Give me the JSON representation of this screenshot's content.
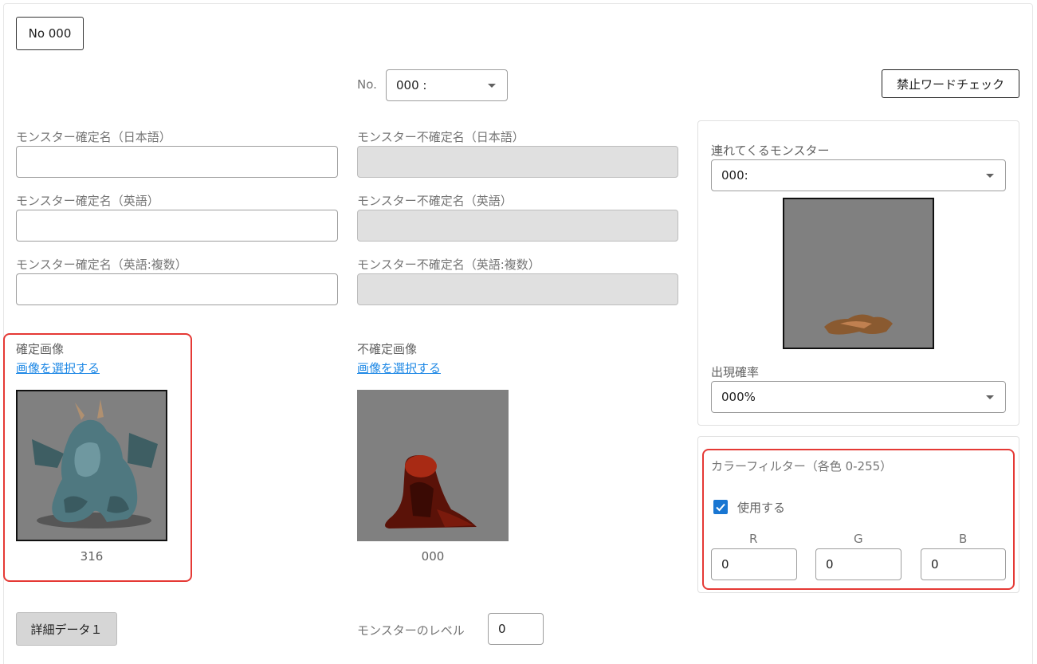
{
  "header": {
    "no_badge": "No 000"
  },
  "no_select": {
    "label": "No.",
    "value": "000 :"
  },
  "ng_word_button": "禁止ワードチェック",
  "names": {
    "confirmed_ja_label": "モンスター確定名（日本語）",
    "confirmed_ja_value": "",
    "unconfirmed_ja_label": "モンスター不確定名（日本語）",
    "confirmed_en_label": "モンスター確定名（英語）",
    "confirmed_en_value": "",
    "unconfirmed_en_label": "モンスター不確定名（英語）",
    "confirmed_en_plural_label": "モンスター確定名（英語:複数）",
    "confirmed_en_plural_value": "",
    "unconfirmed_en_plural_label": "モンスター不確定名（英語:複数）"
  },
  "confirmed_image": {
    "label": "確定画像",
    "select_link": "画像を選択する",
    "caption": "316",
    "icon": "demon-monster-image"
  },
  "unconfirmed_image": {
    "label": "不確定画像",
    "select_link": "画像を選択する",
    "caption": "000",
    "icon": "slime-monster-image"
  },
  "companion": {
    "label": "連れてくるモンスター",
    "value": "000:",
    "icon": "flat-monster-image",
    "appearance_label": "出現確率",
    "appearance_value": "000%"
  },
  "color_filter": {
    "title": "カラーフィルター（各色 0-255）",
    "use_label": "使用する",
    "use_checked": true,
    "r_label": "R",
    "r_value": "0",
    "g_label": "G",
    "g_value": "0",
    "b_label": "B",
    "b_value": "0"
  },
  "detail_button": "詳細データ１",
  "level": {
    "label": "モンスターのレベル",
    "value": "0"
  },
  "colors": {
    "highlight": "#e53935",
    "link": "#1e88e5",
    "checkbox": "#1976d2",
    "image_bg": "#808080"
  }
}
